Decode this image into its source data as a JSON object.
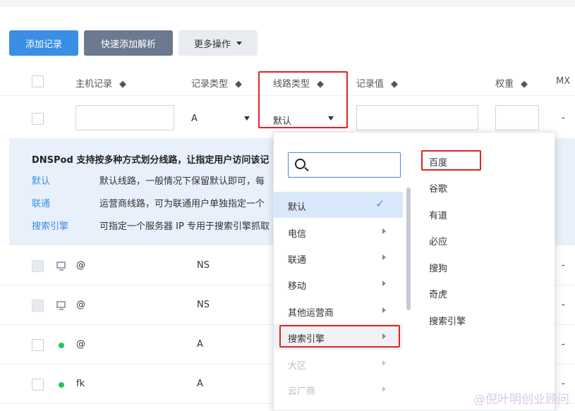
{
  "toolbar": {
    "add_record": "添加记录",
    "quick_add": "快速添加解析",
    "more_ops": "更多操作"
  },
  "table": {
    "headers": {
      "host": "主机记录",
      "type": "记录类型",
      "line": "线路类型",
      "value": "记录值",
      "weight": "权重",
      "mx": "MX"
    },
    "edit_row": {
      "type_value": "A",
      "line_value": "默认",
      "mx_value": "-"
    },
    "rows": [
      {
        "host": "@",
        "type": "NS",
        "mx": "-",
        "icon": "monitor"
      },
      {
        "host": "@",
        "type": "NS",
        "mx": "-",
        "icon": "monitor"
      },
      {
        "host": "@",
        "type": "A",
        "mx": "-",
        "icon": "status-dot"
      },
      {
        "host": "fk",
        "type": "A",
        "mx": "-",
        "icon": "status-dot"
      }
    ]
  },
  "info": {
    "title": "DNSPod 支持按多种方式划分线路，让指定用户访问该记",
    "items": [
      {
        "key": "默认",
        "desc": "默认线路，一般情况下保留默认即可，每"
      },
      {
        "key": "联通",
        "desc": "运营商线路，可为联通用户单独指定一个"
      },
      {
        "key": "搜索引擎",
        "desc": "可指定一个服务器 IP 专用于搜索引擎抓取"
      }
    ]
  },
  "dropdown": {
    "search_placeholder": "",
    "menu": [
      {
        "label": "默认",
        "state": "selected"
      },
      {
        "label": "电信",
        "state": "normal"
      },
      {
        "label": "联通",
        "state": "normal"
      },
      {
        "label": "移动",
        "state": "normal"
      },
      {
        "label": "其他运营商",
        "state": "normal"
      },
      {
        "label": "搜索引擎",
        "state": "hover"
      },
      {
        "label": "大区",
        "state": "disabled"
      },
      {
        "label": "云厂商",
        "state": "disabled"
      }
    ],
    "submenu": [
      "百度",
      "谷歌",
      "有道",
      "必应",
      "搜狗",
      "奇虎",
      "搜索引擎"
    ]
  },
  "watermark": "@倪叶明创业顾问",
  "colors": {
    "primary": "#3a8ee6",
    "highlight": "#e02424",
    "status_green": "#22c55e",
    "info_bg": "#e8f0fb"
  }
}
